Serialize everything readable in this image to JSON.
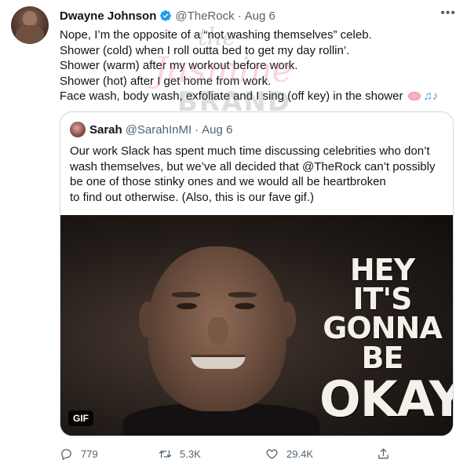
{
  "tweet": {
    "author_name": "Dwayne Johnson",
    "author_handle": "@TheRock",
    "separator": "·",
    "time": "Aug 6",
    "more_icon": "more-horizontal-icon",
    "lines": [
      "Nope, I’m the opposite of a “not washing themselves” celeb.",
      "Shower (cold) when I roll outta bed to get my day rollin’.",
      "Shower (warm) after my workout before work.",
      "Shower (hot) after I get home from work.",
      "Face wash, body wash, exfoliate and I sing (off key) in the shower"
    ],
    "emoji_icons": [
      "soap-emoji-icon",
      "musical-notes-emoji-icon"
    ],
    "emoji_notes": "♫♪"
  },
  "watermark": {
    "line1": "the",
    "line2": "Jasmine",
    "line3": "BRAND"
  },
  "quoted_tweet": {
    "author_name": "Sarah",
    "author_handle": "@SarahInMI",
    "separator": "·",
    "time": "Aug 6",
    "lines": [
      "Our work Slack has spent much time discussing celebrities who don’t",
      "wash themselves, but we’ve all decided that @TheRock can’t possibly",
      "be one of those stinky ones and we would all be heartbroken",
      "to find out otherwise. (Also, this is our fave gif.)"
    ],
    "media": {
      "overlay_line1": "HEY IT'S",
      "overlay_line2": "GONNA BE",
      "overlay_line3": "OKAY",
      "badge": "GIF"
    }
  },
  "actions": {
    "reply_count": "779",
    "retweet_count": "5.3K",
    "like_count": "29.4K",
    "icons": [
      "reply-icon",
      "retweet-icon",
      "like-icon",
      "share-icon"
    ]
  },
  "colors": {
    "text": "#0f1419",
    "muted": "#536471",
    "verified": "#1d9bf0",
    "border": "#cfd9de"
  }
}
